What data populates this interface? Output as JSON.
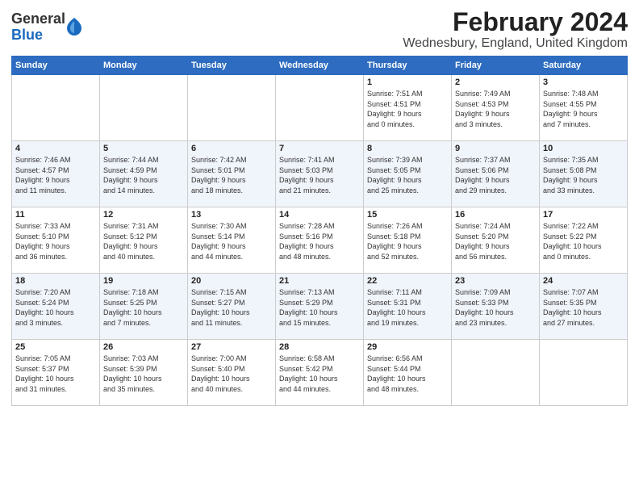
{
  "header": {
    "logo_general": "General",
    "logo_blue": "Blue",
    "title": "February 2024",
    "subtitle": "Wednesbury, England, United Kingdom"
  },
  "weekdays": [
    "Sunday",
    "Monday",
    "Tuesday",
    "Wednesday",
    "Thursday",
    "Friday",
    "Saturday"
  ],
  "weeks": [
    [
      {
        "day": "",
        "info": ""
      },
      {
        "day": "",
        "info": ""
      },
      {
        "day": "",
        "info": ""
      },
      {
        "day": "",
        "info": ""
      },
      {
        "day": "1",
        "info": "Sunrise: 7:51 AM\nSunset: 4:51 PM\nDaylight: 9 hours\nand 0 minutes."
      },
      {
        "day": "2",
        "info": "Sunrise: 7:49 AM\nSunset: 4:53 PM\nDaylight: 9 hours\nand 3 minutes."
      },
      {
        "day": "3",
        "info": "Sunrise: 7:48 AM\nSunset: 4:55 PM\nDaylight: 9 hours\nand 7 minutes."
      }
    ],
    [
      {
        "day": "4",
        "info": "Sunrise: 7:46 AM\nSunset: 4:57 PM\nDaylight: 9 hours\nand 11 minutes."
      },
      {
        "day": "5",
        "info": "Sunrise: 7:44 AM\nSunset: 4:59 PM\nDaylight: 9 hours\nand 14 minutes."
      },
      {
        "day": "6",
        "info": "Sunrise: 7:42 AM\nSunset: 5:01 PM\nDaylight: 9 hours\nand 18 minutes."
      },
      {
        "day": "7",
        "info": "Sunrise: 7:41 AM\nSunset: 5:03 PM\nDaylight: 9 hours\nand 21 minutes."
      },
      {
        "day": "8",
        "info": "Sunrise: 7:39 AM\nSunset: 5:05 PM\nDaylight: 9 hours\nand 25 minutes."
      },
      {
        "day": "9",
        "info": "Sunrise: 7:37 AM\nSunset: 5:06 PM\nDaylight: 9 hours\nand 29 minutes."
      },
      {
        "day": "10",
        "info": "Sunrise: 7:35 AM\nSunset: 5:08 PM\nDaylight: 9 hours\nand 33 minutes."
      }
    ],
    [
      {
        "day": "11",
        "info": "Sunrise: 7:33 AM\nSunset: 5:10 PM\nDaylight: 9 hours\nand 36 minutes."
      },
      {
        "day": "12",
        "info": "Sunrise: 7:31 AM\nSunset: 5:12 PM\nDaylight: 9 hours\nand 40 minutes."
      },
      {
        "day": "13",
        "info": "Sunrise: 7:30 AM\nSunset: 5:14 PM\nDaylight: 9 hours\nand 44 minutes."
      },
      {
        "day": "14",
        "info": "Sunrise: 7:28 AM\nSunset: 5:16 PM\nDaylight: 9 hours\nand 48 minutes."
      },
      {
        "day": "15",
        "info": "Sunrise: 7:26 AM\nSunset: 5:18 PM\nDaylight: 9 hours\nand 52 minutes."
      },
      {
        "day": "16",
        "info": "Sunrise: 7:24 AM\nSunset: 5:20 PM\nDaylight: 9 hours\nand 56 minutes."
      },
      {
        "day": "17",
        "info": "Sunrise: 7:22 AM\nSunset: 5:22 PM\nDaylight: 10 hours\nand 0 minutes."
      }
    ],
    [
      {
        "day": "18",
        "info": "Sunrise: 7:20 AM\nSunset: 5:24 PM\nDaylight: 10 hours\nand 3 minutes."
      },
      {
        "day": "19",
        "info": "Sunrise: 7:18 AM\nSunset: 5:25 PM\nDaylight: 10 hours\nand 7 minutes."
      },
      {
        "day": "20",
        "info": "Sunrise: 7:15 AM\nSunset: 5:27 PM\nDaylight: 10 hours\nand 11 minutes."
      },
      {
        "day": "21",
        "info": "Sunrise: 7:13 AM\nSunset: 5:29 PM\nDaylight: 10 hours\nand 15 minutes."
      },
      {
        "day": "22",
        "info": "Sunrise: 7:11 AM\nSunset: 5:31 PM\nDaylight: 10 hours\nand 19 minutes."
      },
      {
        "day": "23",
        "info": "Sunrise: 7:09 AM\nSunset: 5:33 PM\nDaylight: 10 hours\nand 23 minutes."
      },
      {
        "day": "24",
        "info": "Sunrise: 7:07 AM\nSunset: 5:35 PM\nDaylight: 10 hours\nand 27 minutes."
      }
    ],
    [
      {
        "day": "25",
        "info": "Sunrise: 7:05 AM\nSunset: 5:37 PM\nDaylight: 10 hours\nand 31 minutes."
      },
      {
        "day": "26",
        "info": "Sunrise: 7:03 AM\nSunset: 5:39 PM\nDaylight: 10 hours\nand 35 minutes."
      },
      {
        "day": "27",
        "info": "Sunrise: 7:00 AM\nSunset: 5:40 PM\nDaylight: 10 hours\nand 40 minutes."
      },
      {
        "day": "28",
        "info": "Sunrise: 6:58 AM\nSunset: 5:42 PM\nDaylight: 10 hours\nand 44 minutes."
      },
      {
        "day": "29",
        "info": "Sunrise: 6:56 AM\nSunset: 5:44 PM\nDaylight: 10 hours\nand 48 minutes."
      },
      {
        "day": "",
        "info": ""
      },
      {
        "day": "",
        "info": ""
      }
    ]
  ]
}
